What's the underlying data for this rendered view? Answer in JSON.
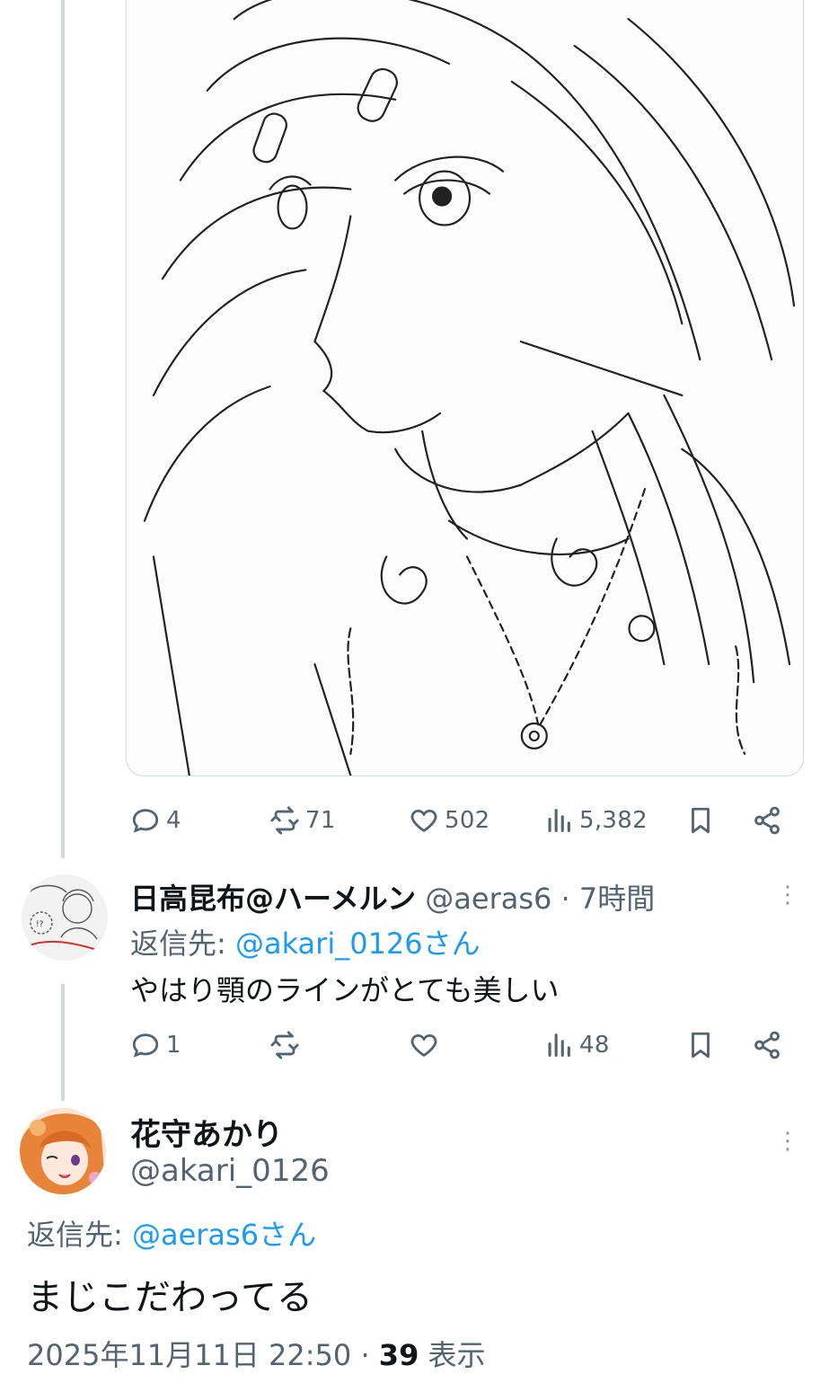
{
  "first_tweet": {
    "image_alt_icon": "anime-girl-lineart-illustration",
    "actions": {
      "replies": "4",
      "retweets": "71",
      "likes": "502",
      "views": "5,382"
    }
  },
  "reply": {
    "display_name": "日高昆布@ハーメルン",
    "handle": "@aeras6",
    "separator": "·",
    "time": "7時間",
    "replying_prefix": "返信先: ",
    "replying_to": "@akari_0126さん",
    "text": "やはり顎のラインがとても美しい",
    "actions": {
      "replies": "1",
      "retweets": "",
      "likes": "",
      "views": "48"
    }
  },
  "main_tweet": {
    "display_name": "花守あかり",
    "handle": "@akari_0126",
    "replying_prefix": "返信先: ",
    "replying_to": "@aeras6さん",
    "text": "まじこだわってる",
    "date": "2025年11月11日 22:50",
    "separator": "·",
    "views_count": "39",
    "views_label": "表示"
  },
  "colors": {
    "link": "#1d9bf0",
    "secondary_text": "#536471",
    "primary_text": "#0f1419",
    "thread_line": "#cfd9de"
  },
  "icons": [
    "reply-icon",
    "retweet-icon",
    "like-icon",
    "views-icon",
    "bookmark-icon",
    "share-icon",
    "more-icon"
  ]
}
